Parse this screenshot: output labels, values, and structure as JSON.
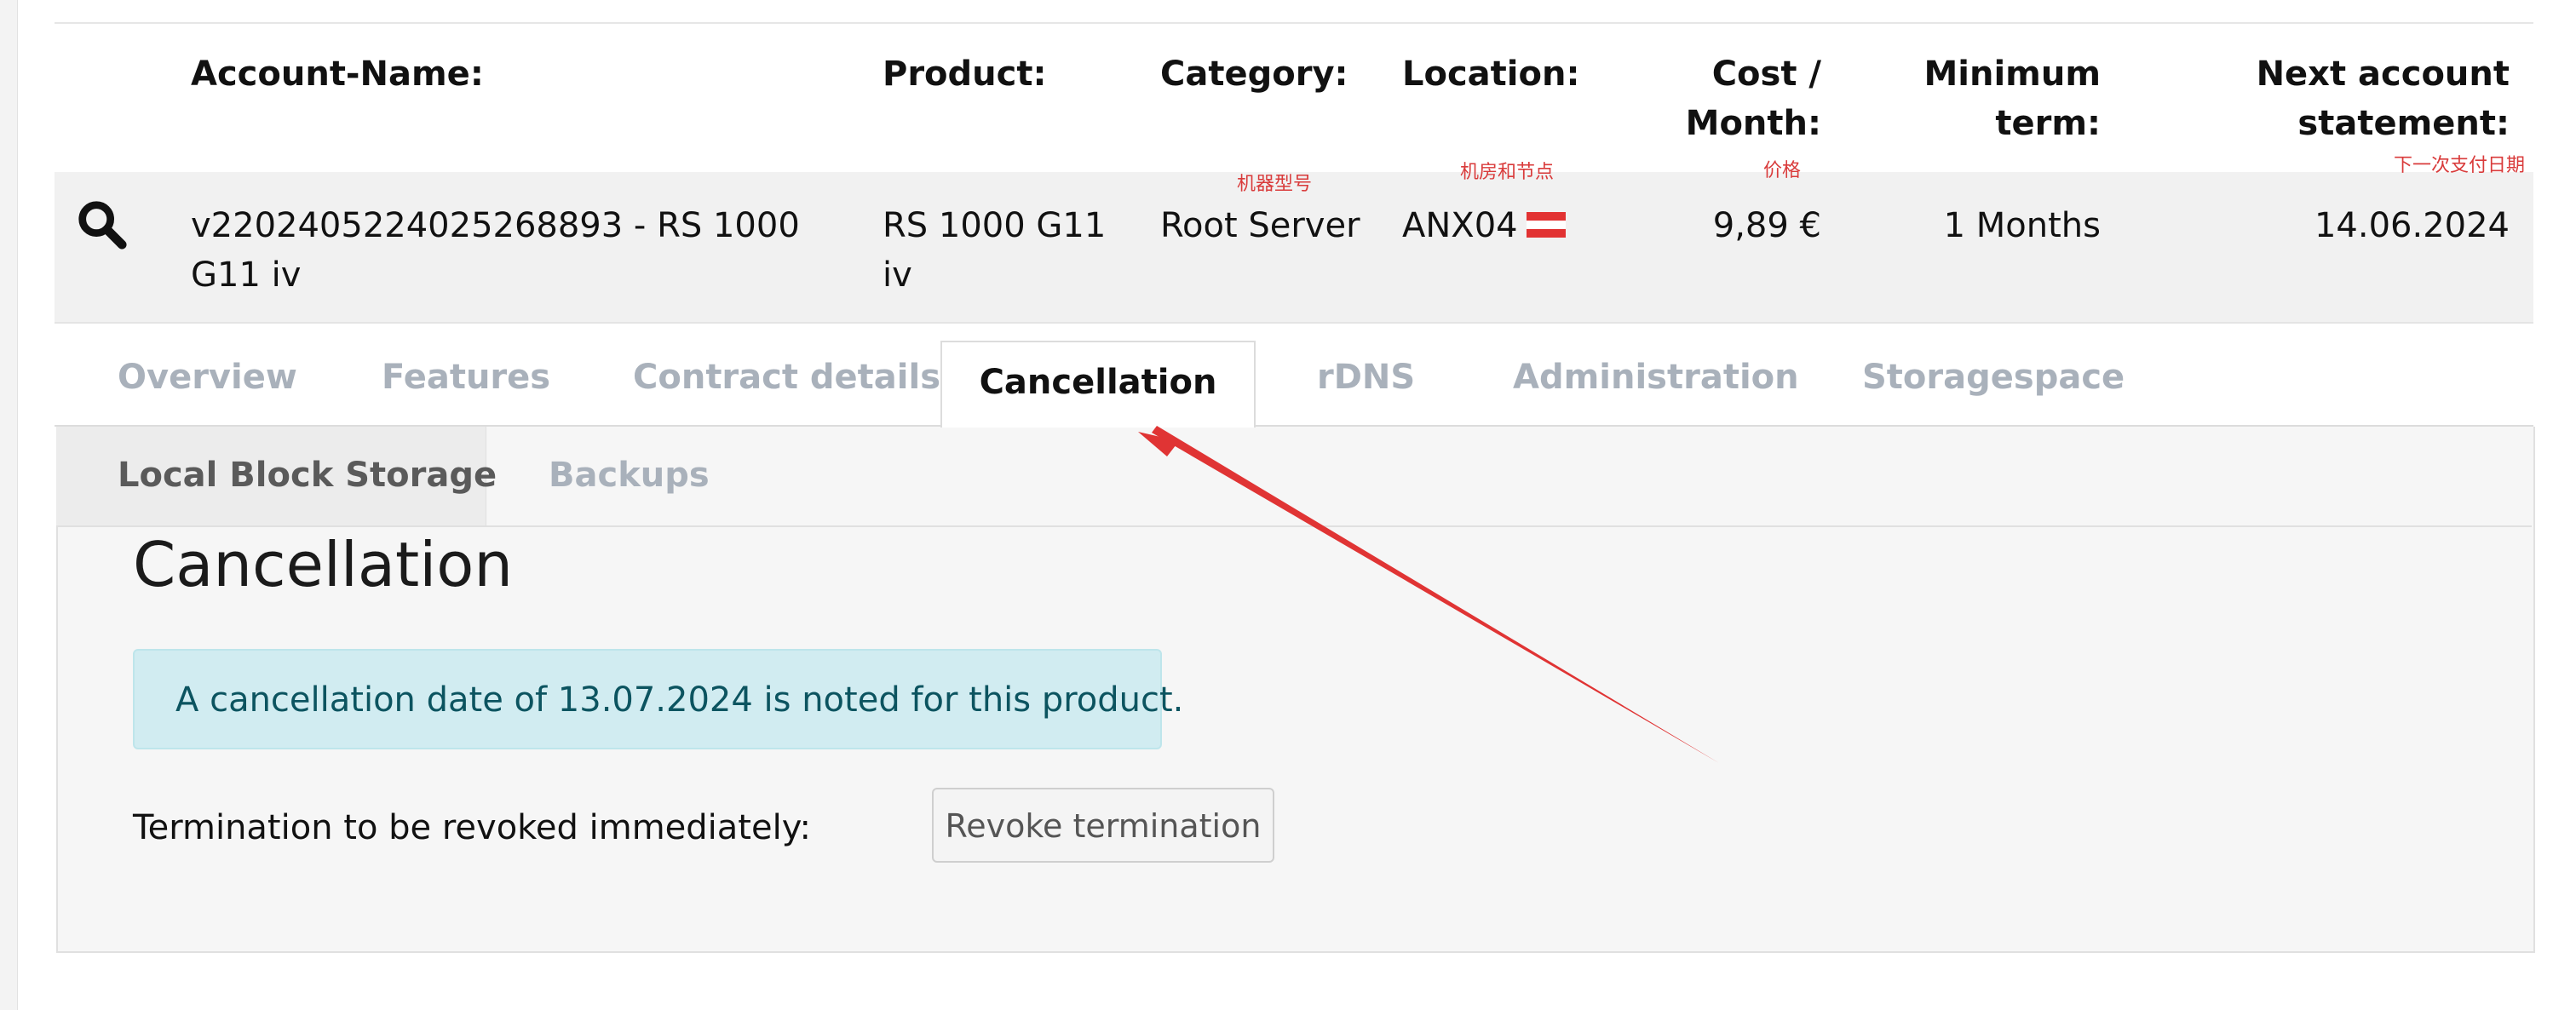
{
  "table": {
    "headers": {
      "account_name": "Account-Name:",
      "product": "Product:",
      "category": "Category:",
      "location": "Location:",
      "cost_line1": "Cost /",
      "cost_line2": "Month:",
      "min_term_line1": "Minimum",
      "min_term_line2": "term:",
      "next_statement_line1": "Next account",
      "next_statement_line2": "statement:"
    },
    "row": {
      "account_name_line1": "v2202405224025268893 - RS 1000",
      "account_name_line2": "G11 iv",
      "product_line1": "RS 1000 G11",
      "product_line2": "iv",
      "category": "Root Server",
      "location": "ANX04",
      "cost": "9,89 €",
      "min_term": "1 Months",
      "next_statement": "14.06.2024"
    }
  },
  "annotations": {
    "model": "机器型号",
    "node": "机房和节点",
    "price": "价格",
    "next_payment": "下一次支付日期"
  },
  "tabs": [
    {
      "label": "Overview",
      "active": false
    },
    {
      "label": "Features",
      "active": false
    },
    {
      "label": "Contract details",
      "active": false
    },
    {
      "label": "Cancellation",
      "active": true
    },
    {
      "label": "rDNS",
      "active": false
    },
    {
      "label": "Administration",
      "active": false
    },
    {
      "label": "Storagespace",
      "active": false
    }
  ],
  "subtabs": [
    {
      "label": "Local Block Storage",
      "active": true
    },
    {
      "label": "Backups",
      "active": false
    }
  ],
  "cancellation": {
    "title": "Cancellation",
    "alert": "A cancellation date of 13.07.2024 is noted for this product.",
    "revoke_label": "Termination to be revoked immediately:",
    "revoke_button": "Revoke termination"
  },
  "colors": {
    "annotation_red": "#d93b3b",
    "alert_bg": "#d1ecf1",
    "alert_text": "#0c5460",
    "inactive_tab": "#a9b1bb"
  },
  "icons": {
    "search": "search-icon",
    "flag": "austria-flag-icon"
  }
}
